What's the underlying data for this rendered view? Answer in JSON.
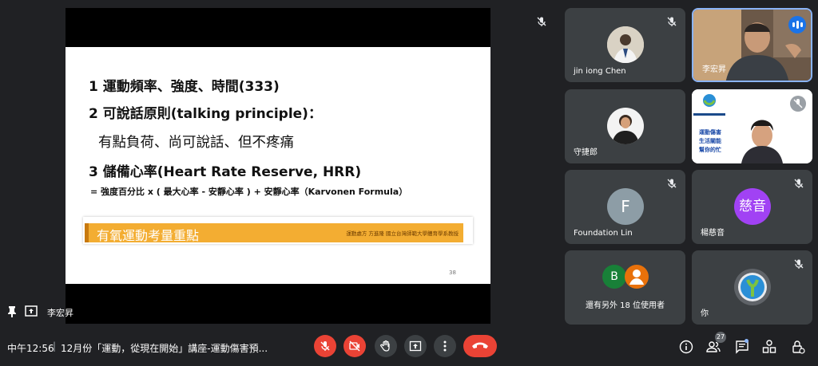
{
  "slide": {
    "line1": "1 運動頻率、強度、時間(333)",
    "line2": "2 可說話原則(talking principle)：",
    "line3": "有點負荷、尚可說話、但不疼痛",
    "line4": "3 儲備心率(Heart Rate Reserve, HRR)",
    "formula": "= 強度百分比 x ( 最大心率 - 安靜心率 ) + 安靜心率（Karvonen Formula）",
    "banner_title": "有氧運動考量重點",
    "banner_note": "運動處方 方進隆 國立台灣師範大學體育學系教授",
    "page_number": "38"
  },
  "presenter": {
    "name": "李宏昇"
  },
  "participants": [
    {
      "name": "jin iong Chen",
      "muted": true
    },
    {
      "name": "李宏昇",
      "speaking": true
    },
    {
      "name": "守捷郎",
      "muted": false
    },
    {
      "name": "",
      "muted": true,
      "logo_text": [
        "運動傷害",
        "生活關能",
        "幫你的忙"
      ]
    },
    {
      "name": "Foundation Lin",
      "avatar_letter": "F",
      "avatar_color": "#8d9da6",
      "muted": true
    },
    {
      "name": "楊慈音",
      "avatar_letter": "慈音",
      "avatar_color": "#a142f4",
      "muted": true
    },
    {
      "name": "還有另外 18 位使用者",
      "avatars": [
        {
          "letter": "B",
          "color": "#188038"
        },
        {
          "letter": "",
          "color": "#e8710a"
        }
      ]
    },
    {
      "name": "你",
      "muted": true
    }
  ],
  "bottombar": {
    "time": "中午12:56",
    "meeting_title": "12月份「運動，從現在開始」講座-運動傷害預...",
    "people_count": "27"
  },
  "colors": {
    "banner": "#f3ad32",
    "danger": "#ea4335",
    "accent": "#8ab4f8"
  },
  "icons": [
    "pin-icon",
    "present-icon",
    "mic-off-icon",
    "camera-off-icon",
    "raise-hand-icon",
    "present-now-icon",
    "more-options-icon",
    "leave-call-icon",
    "info-icon",
    "people-icon",
    "chat-icon",
    "activities-icon",
    "host-controls-icon"
  ]
}
